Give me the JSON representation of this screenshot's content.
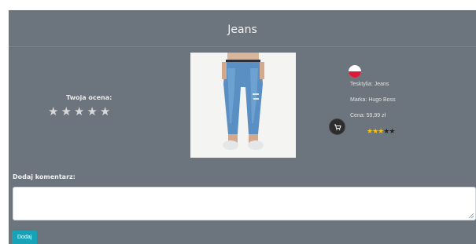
{
  "product": {
    "title": "Jeans",
    "image_alt": "jeans-photo",
    "flag_icon": "poland-flag-icon",
    "material": "Tesktylia: Jeans",
    "brand": "Marka: Hugo Boss",
    "price": "Cena: 59,99 zł",
    "average_rating": {
      "value": 3,
      "max": 5
    }
  },
  "rating": {
    "label": "Twoja ocena:",
    "stars": [
      "★",
      "★",
      "★",
      "★",
      "★"
    ]
  },
  "comment": {
    "label": "Dodaj komentarz:",
    "value": "",
    "placeholder": ""
  },
  "actions": {
    "add_label": "Dodaj",
    "cart_icon": "cart-icon"
  },
  "colors": {
    "panel": "#6c757d",
    "button": "#17a2b8",
    "star_filled": "#f6c21a"
  }
}
